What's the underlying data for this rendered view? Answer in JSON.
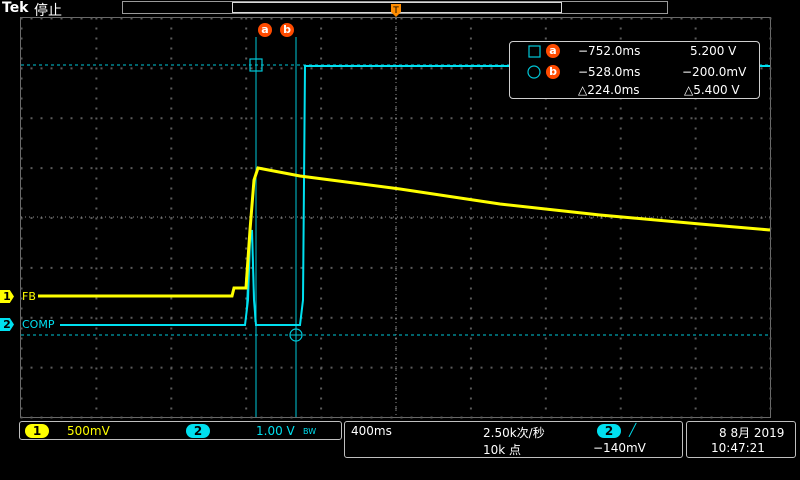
{
  "header": {
    "brand": "Tek",
    "state": "停止"
  },
  "cursor_badges": {
    "a": "a",
    "b": "b"
  },
  "cursor_readout": {
    "a_time": "−752.0ms",
    "a_value": "5.200 V",
    "b_time": "−528.0ms",
    "b_value": "−200.0mV",
    "delta_time": "△224.0ms",
    "delta_value": "△5.400 V"
  },
  "channels": [
    {
      "number": "1",
      "label": "FB",
      "scale": "500mV",
      "color": "#ffff00"
    },
    {
      "number": "2",
      "label": "COMP",
      "scale": "1.00 V",
      "color": "#00e0f0"
    }
  ],
  "bandwidth": "BW",
  "horizontal": {
    "timebase": "400ms",
    "sample_rate": "2.50k次/秒",
    "record_length": "10k 点"
  },
  "trigger": {
    "source": "2",
    "slope": "╱",
    "level": "−140mV"
  },
  "datetime": {
    "date": "8 8月 2019",
    "time": "10:47:21"
  },
  "icons": {
    "trigger_position": "trigger-t-marker-icon",
    "cursor_a": "square-cursor-icon",
    "cursor_b": "circle-cursor-icon"
  }
}
